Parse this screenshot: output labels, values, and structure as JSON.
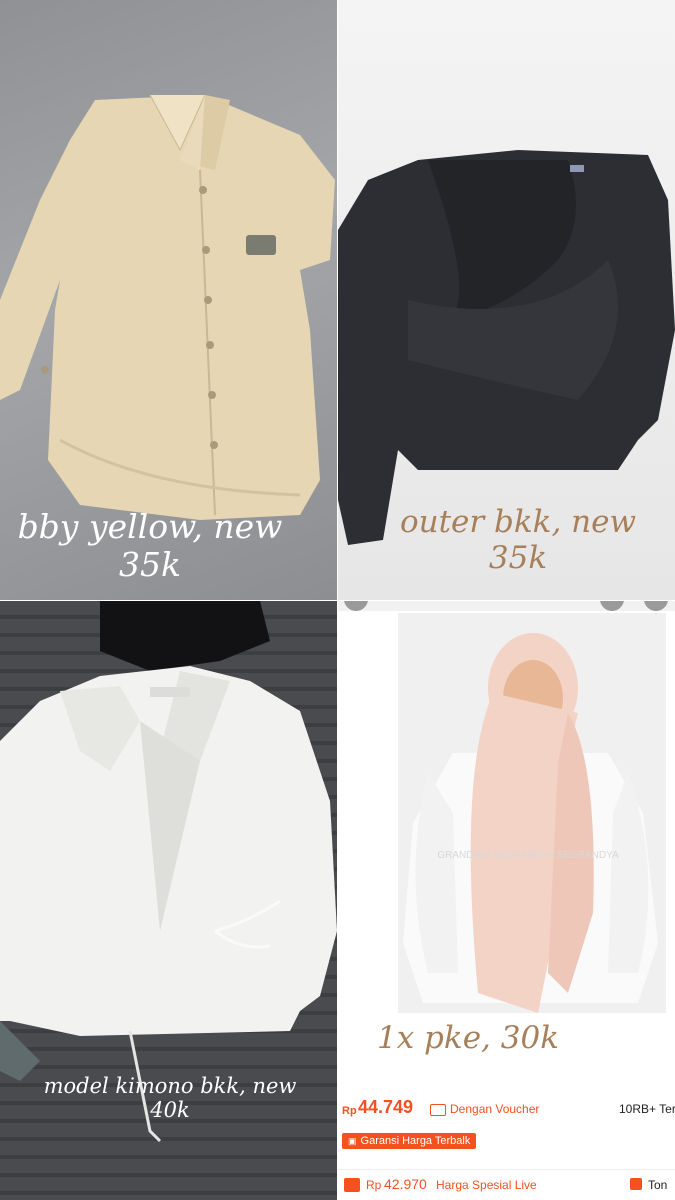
{
  "tiles": [
    {
      "caption_line1": "bby yellow, new",
      "caption_line2": "35k"
    },
    {
      "caption_line1": "outer bkk,  new",
      "caption_line2": "35k"
    },
    {
      "caption_line1": "model kimono bkk, new",
      "caption_line2": "40k"
    },
    {
      "caption": "1x pke, 30k"
    }
  ],
  "product": {
    "currency": "Rp",
    "price": "44.749",
    "voucher_label": "Dengan Voucher",
    "sold": "10RB+ Ter",
    "guarantee": "Garansi Harga Terbalk",
    "live_currency": "Rp",
    "live_price": "42.970",
    "live_label": "Harga Spesial Live",
    "cart_text": "Ton",
    "watermark": "GRANDINA SEGRANDYA SEGRANDYA"
  },
  "colors": {
    "caption_brown": "#a7805a",
    "price_orange": "#f4511e",
    "shirt_yellow": "#e6d6b3",
    "shirt_black": "#2c2e33",
    "shirt_white": "#f2f2f0",
    "hijab_pink": "#f3d3c6"
  }
}
